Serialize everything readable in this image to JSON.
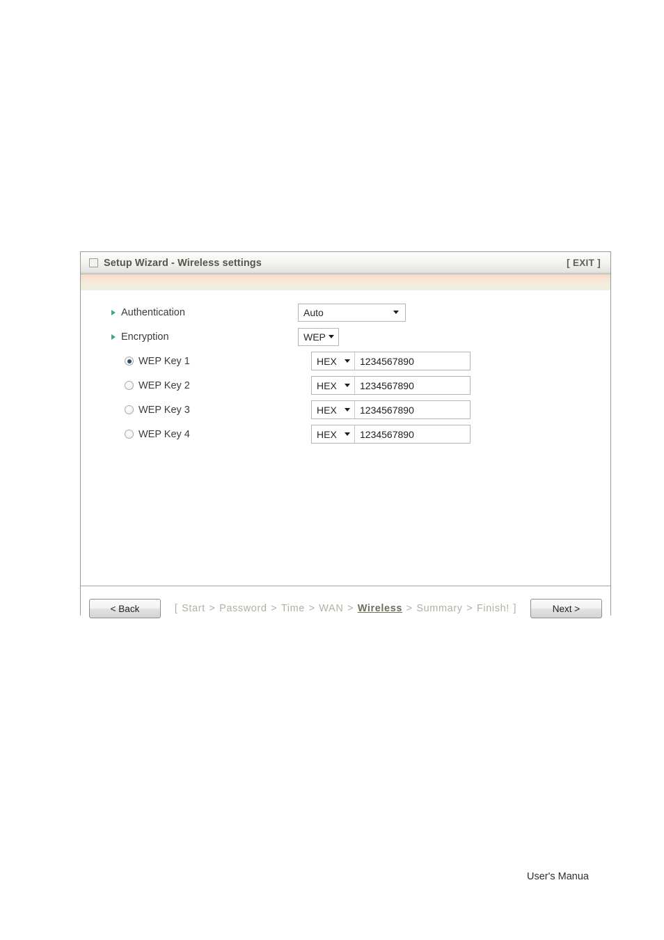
{
  "page": {
    "footer_text": "User's Manua"
  },
  "panel": {
    "title": "Setup Wizard - Wireless settings",
    "exit_label": "[ EXIT ]",
    "icon": "window-icon"
  },
  "form": {
    "authentication": {
      "label": "Authentication",
      "value": "Auto"
    },
    "encryption": {
      "label": "Encryption",
      "value": "WEP"
    },
    "wep_keys": [
      {
        "label": "WEP Key 1",
        "selected": true,
        "format": "HEX",
        "value": "1234567890"
      },
      {
        "label": "WEP Key 2",
        "selected": false,
        "format": "HEX",
        "value": "1234567890"
      },
      {
        "label": "WEP Key 3",
        "selected": false,
        "format": "HEX",
        "value": "1234567890"
      },
      {
        "label": "WEP Key 4",
        "selected": false,
        "format": "HEX",
        "value": "1234567890"
      }
    ]
  },
  "footer": {
    "back_label": "< Back",
    "next_label": "Next >",
    "breadcrumb": {
      "open_bracket": "[",
      "close_bracket": "]",
      "separator": ">",
      "steps": [
        {
          "label": "Start",
          "active": false
        },
        {
          "label": "Password",
          "active": false
        },
        {
          "label": "Time",
          "active": false
        },
        {
          "label": "WAN",
          "active": false
        },
        {
          "label": "Wireless",
          "active": true
        },
        {
          "label": "Summary",
          "active": false
        },
        {
          "label": "Finish!",
          "active": false
        }
      ]
    }
  },
  "colors": {
    "accent_band_top": "#f5d9c8",
    "accent_band_bottom": "#edf0e2",
    "title_text": "#55564a",
    "bullet_arrow": "#3fa58e",
    "radio_dot": "#28506e",
    "breadcrumb_inactive": "#b0b0a2",
    "breadcrumb_active": "#6d6e5c"
  }
}
